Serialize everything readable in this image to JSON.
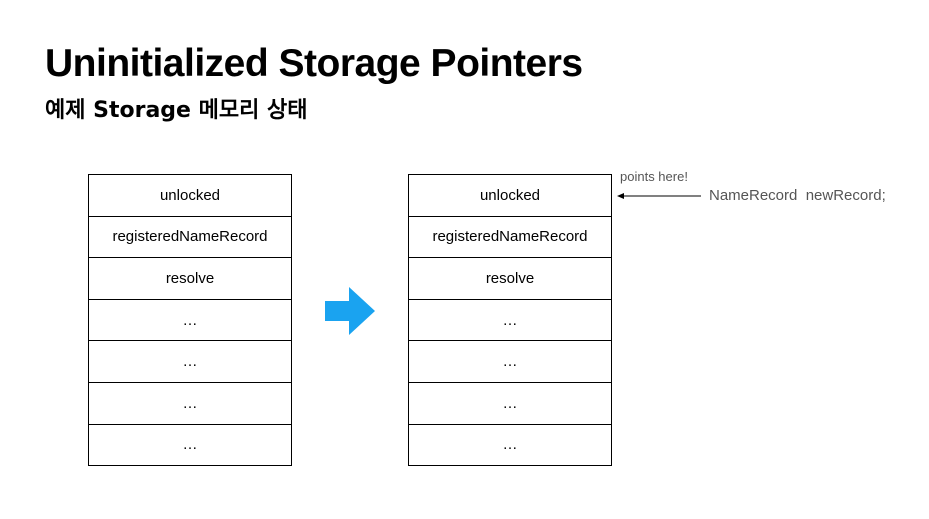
{
  "title": "Uninitialized Storage Pointers",
  "subtitle": "예제 Storage 메모리 상태",
  "left_table": {
    "rows": [
      "unlocked",
      "registeredNameRecord",
      "resolve",
      "…",
      "…",
      "…",
      "…"
    ]
  },
  "right_table": {
    "rows": [
      "unlocked",
      "registeredNameRecord",
      "resolve",
      "…",
      "…",
      "…",
      "…"
    ]
  },
  "annotation": {
    "note": "points here!",
    "declaration": "NameRecord  newRecord;"
  },
  "colors": {
    "arrow": "#1aa3f0",
    "annotation_text": "#555555"
  },
  "icons": {
    "transition": "right-arrow-icon"
  }
}
